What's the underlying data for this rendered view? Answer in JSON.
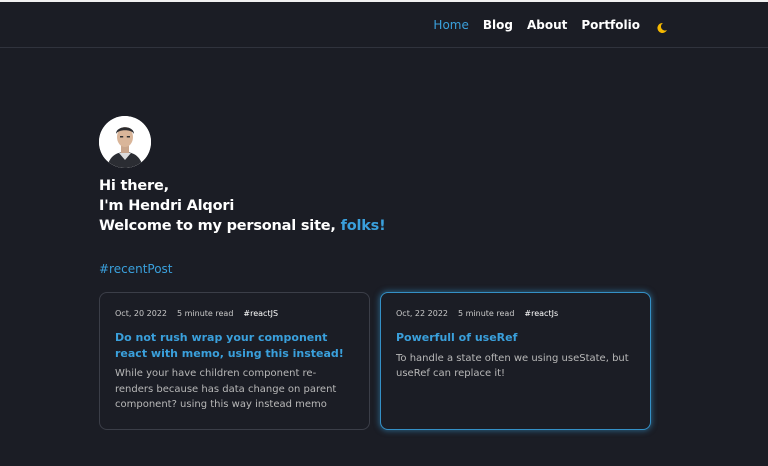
{
  "nav": {
    "items": [
      {
        "label": "Home",
        "active": true
      },
      {
        "label": "Blog",
        "active": false
      },
      {
        "label": "About",
        "active": false
      },
      {
        "label": "Portfolio",
        "active": false
      }
    ],
    "theme_icon": "moon-icon"
  },
  "hero": {
    "line1": "Hi there,",
    "line2": "I'm Hendri Alqori",
    "line3_prefix": "Welcome to my personal site, ",
    "line3_accent": "folks!"
  },
  "section": {
    "title": "#recentPost"
  },
  "posts": [
    {
      "date": "Oct, 20 2022",
      "read_time": "5 minute read",
      "tag": "#reactJS",
      "title": "Do not rush wrap your component react with memo, using this instead!",
      "excerpt": "While your have children component re-renders because has data change on parent component? using this way instead memo"
    },
    {
      "date": "Oct, 22 2022",
      "read_time": "5 minute read",
      "tag": "#reactJs",
      "title": "Powerfull of useRef",
      "excerpt": "To handle a state often we using useState, but useRef can replace it!"
    }
  ],
  "colors": {
    "background": "#1b1d25",
    "accent": "#3aa0dc",
    "moon": "#f5b800"
  }
}
